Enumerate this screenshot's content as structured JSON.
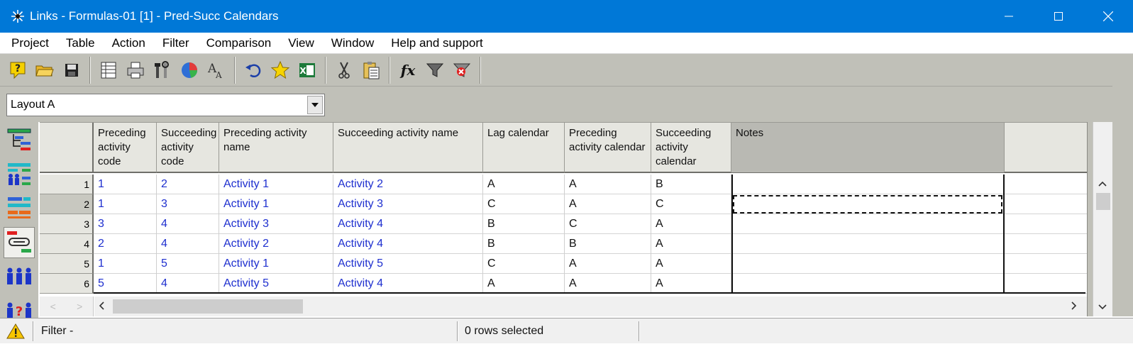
{
  "window": {
    "title": "Links - Formulas-01 [1] - Pred-Succ Calendars",
    "minimize_glyph": "—",
    "maximize_glyph": "☐",
    "close_glyph": "✕"
  },
  "menu": {
    "items": [
      "Project",
      "Table",
      "Action",
      "Filter",
      "Comparison",
      "View",
      "Window",
      "Help and support"
    ]
  },
  "toolbar": {
    "icons": [
      "help-icon",
      "open-folder-icon",
      "save-icon",
      "table-icon",
      "print-icon",
      "tools-icon",
      "pie-chart-icon",
      "font-icon",
      "undo-icon",
      "star-icon",
      "excel-icon",
      "cut-icon",
      "paste-icon",
      "formula-icon",
      "filter-icon",
      "clear-filter-icon"
    ],
    "formula_glyph": "fx"
  },
  "layout": {
    "selected": "Layout A"
  },
  "grid": {
    "columns": [
      "Preceding activity code",
      "Succeeding activity code",
      "Preceding activity name",
      "Succeeding activity name",
      "Lag calendar",
      "Preceding activity calendar",
      "Succeeding activity calendar",
      "Notes"
    ],
    "rows": [
      {
        "num": "1",
        "pred_code": "1",
        "succ_code": "2",
        "pred_name": "Activity 1",
        "succ_name": "Activity 2",
        "lag_cal": "A",
        "pred_cal": "A",
        "succ_cal": "B",
        "notes": ""
      },
      {
        "num": "2",
        "pred_code": "1",
        "succ_code": "3",
        "pred_name": "Activity 1",
        "succ_name": "Activity 3",
        "lag_cal": "C",
        "pred_cal": "A",
        "succ_cal": "C",
        "notes": ""
      },
      {
        "num": "3",
        "pred_code": "3",
        "succ_code": "4",
        "pred_name": "Activity 3",
        "succ_name": "Activity 4",
        "lag_cal": "B",
        "pred_cal": "C",
        "succ_cal": "A",
        "notes": ""
      },
      {
        "num": "4",
        "pred_code": "2",
        "succ_code": "4",
        "pred_name": "Activity 2",
        "succ_name": "Activity 4",
        "lag_cal": "B",
        "pred_cal": "B",
        "succ_cal": "A",
        "notes": ""
      },
      {
        "num": "5",
        "pred_code": "1",
        "succ_code": "5",
        "pred_name": "Activity 1",
        "succ_name": "Activity 5",
        "lag_cal": "C",
        "pred_cal": "A",
        "succ_cal": "A",
        "notes": ""
      },
      {
        "num": "6",
        "pred_code": "5",
        "succ_code": "4",
        "pred_name": "Activity 5",
        "succ_name": "Activity 4",
        "lag_cal": "A",
        "pred_cal": "A",
        "succ_cal": "A",
        "notes": ""
      }
    ],
    "selected_row": "2"
  },
  "rail": {
    "icons": [
      "gantt-icon",
      "resources-gantt-icon",
      "bars-icon",
      "links-icon",
      "resources-icon",
      "resource-query-icon",
      "cost-icon"
    ],
    "selected": "links-icon"
  },
  "status": {
    "filter_text": "Filter -",
    "rows_selected": "0 rows selected"
  },
  "colors": {
    "titlebar": "#0078d7",
    "link_text": "#1e2fcf",
    "panel": "#c0c0b8"
  }
}
